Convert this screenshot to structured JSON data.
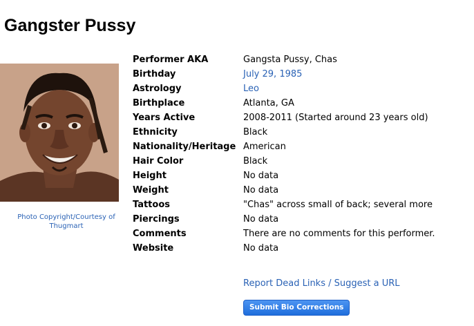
{
  "page_title": "Gangster Pussy",
  "photo": {
    "credit": "Photo Copyright/Courtesy of Thugmart"
  },
  "bio": [
    {
      "label": "Performer AKA",
      "value": "Gangsta Pussy, Chas",
      "link": false
    },
    {
      "label": "Birthday",
      "value": "July 29, 1985",
      "link": true
    },
    {
      "label": "Astrology",
      "value": "Leo",
      "link": true
    },
    {
      "label": "Birthplace",
      "value": "Atlanta, GA",
      "link": false
    },
    {
      "label": "Years Active",
      "value": "2008-2011 (Started around 23 years old)",
      "link": false
    },
    {
      "label": "Ethnicity",
      "value": "Black",
      "link": false
    },
    {
      "label": "Nationality/Heritage",
      "value": "American",
      "link": false
    },
    {
      "label": "Hair Color",
      "value": "Black",
      "link": false
    },
    {
      "label": "Height",
      "value": "No data",
      "link": false
    },
    {
      "label": "Weight",
      "value": "No data",
      "link": false
    },
    {
      "label": "Tattoos",
      "value": "\"Chas\" across small of back; several more",
      "link": false
    },
    {
      "label": "Piercings",
      "value": "No data",
      "link": false
    },
    {
      "label": "Comments",
      "value": "There are no comments for this performer.",
      "link": false
    },
    {
      "label": "Website",
      "value": "No data",
      "link": false
    }
  ],
  "links": {
    "report": "Report Dead Links / Suggest a URL"
  },
  "buttons": {
    "submit_label": "Submit Bio Corrections"
  },
  "colors": {
    "link": "#2a62b5",
    "button": "#1f6edc"
  }
}
